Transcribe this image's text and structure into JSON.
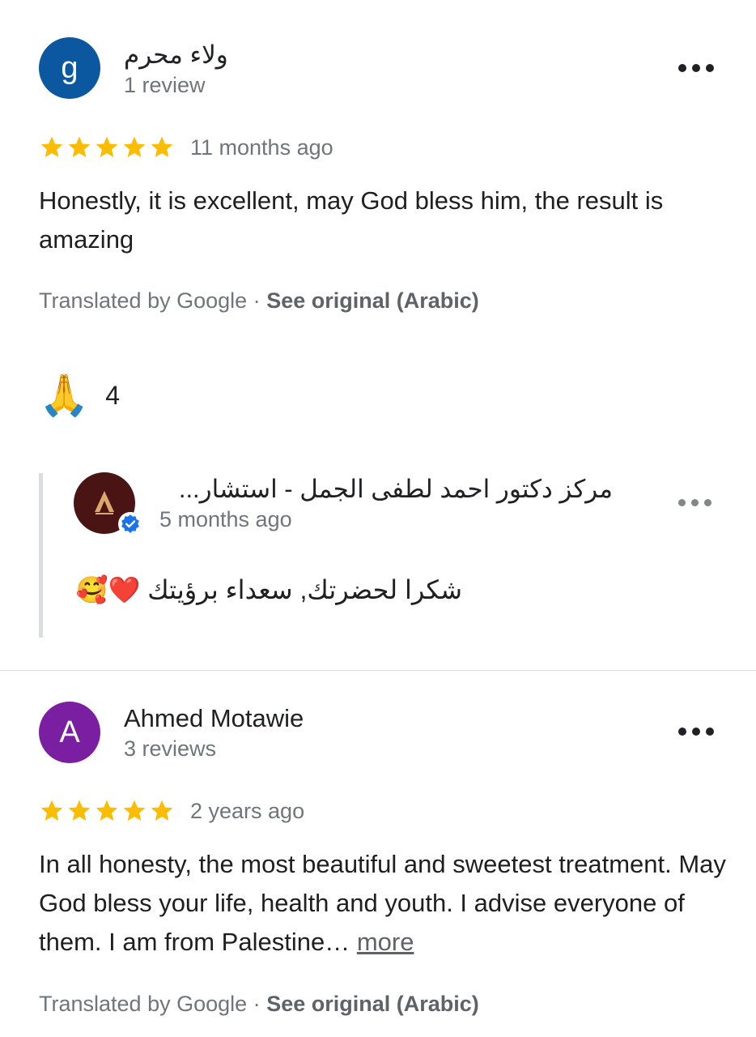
{
  "reviews": [
    {
      "avatar_letter": "g",
      "avatar_color": "#0b57a0",
      "reviewer_name": "ولاء محرم",
      "review_count": "1 review",
      "rating": 5,
      "time": "11 months ago",
      "text": "Honestly, it is excellent, may God bless him, the result is amazing",
      "translated_by": "Translated by Google",
      "separator": "·",
      "see_original": "See original (Arabic)",
      "reaction_emoji": "🙏",
      "reaction_count": "4",
      "owner_reply": {
        "owner_name": "مركز دكتور احمد لطفى الجمل - استشار...",
        "time": "5 months ago",
        "text": "شكرا لحضرتك, سعداء برؤيتك ❤️🥰",
        "verified_color": "#1a73e8"
      }
    },
    {
      "avatar_letter": "A",
      "avatar_color": "#7b1fa2",
      "reviewer_name": "Ahmed Motawie",
      "review_count": "3 reviews",
      "rating": 5,
      "time": "2 years ago",
      "text": "In all honesty, the most beautiful and sweetest treatment. May God bless your life, health and youth. I advise everyone of them. I am from Palestine…",
      "more_label": "more",
      "translated_by": "Translated by Google",
      "separator": "·",
      "see_original": "See original (Arabic)"
    }
  ],
  "star_color": "#fbbc04"
}
